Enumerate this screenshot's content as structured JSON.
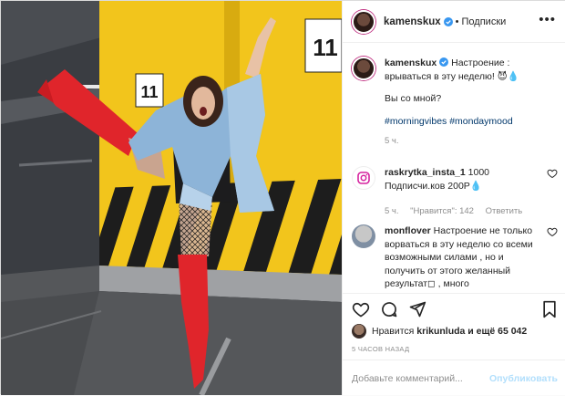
{
  "post": {
    "username": "kamenskux",
    "follow_label": "Подписки",
    "more_icon": "more-horizontal-icon"
  },
  "caption": {
    "username": "kamenskux",
    "line1": "Настроение : врываться в эту неделю! 😈💧",
    "line2": "Вы со мной?",
    "hashtags": "#morningvibes #mondaymood",
    "time": "5 ч."
  },
  "comments": [
    {
      "username": "raskrytka_insta_1",
      "text": " 1000 Подписчи.ков 200Р💧",
      "time": "5 ч.",
      "likes": "\"Нравится\": 142",
      "reply": "Ответить"
    },
    {
      "username": "monflover",
      "text": " Настроение не только ворваться в эту неделю со всеми возможными силами , но и получить от этого желанный результат◻ , много"
    }
  ],
  "likes": {
    "prefix": "Нравится",
    "user": "krikunluda",
    "suffix": "и ещё 65 042"
  },
  "timestamp": "5 ЧАСОВ НАЗАД",
  "comment_box": {
    "placeholder": "Добавьте комментарий...",
    "publish": "Опубликовать"
  },
  "photo": {
    "sign_left": "11",
    "sign_right": "11",
    "colors": {
      "wall": "#f2c51c",
      "boots": "#e0252b",
      "denim": "#8db4d8"
    }
  }
}
